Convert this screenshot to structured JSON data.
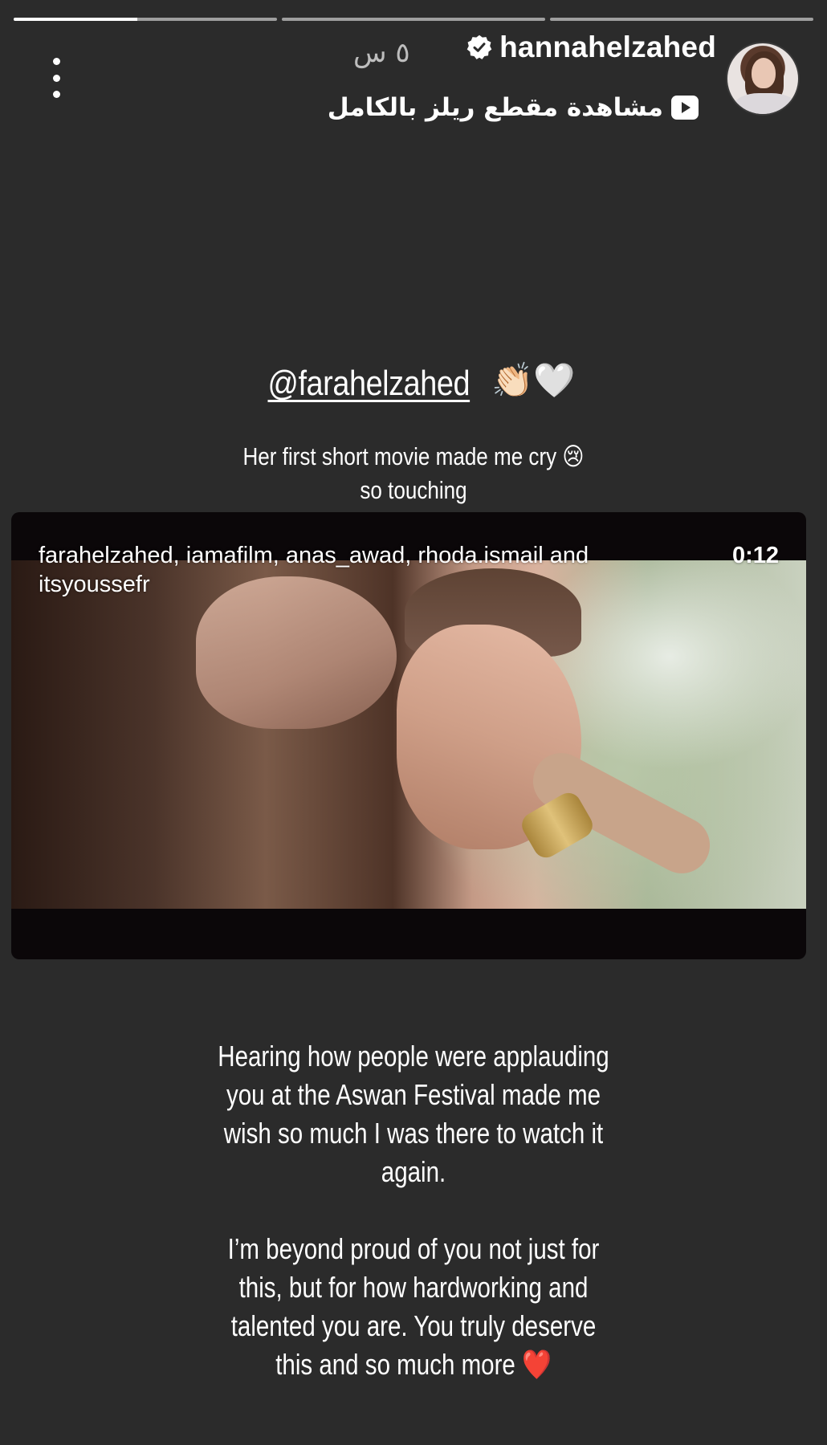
{
  "story": {
    "progress": [
      {
        "fill": 0.47
      },
      {
        "fill": 0
      },
      {
        "fill": 0
      }
    ]
  },
  "header": {
    "username": "hannahelzahed",
    "timestamp": "٥ س",
    "reels_link_label": "مشاهدة مقطع ريلز بالكامل",
    "icons": {
      "verified": "verified-badge-icon",
      "play": "play-icon",
      "more": "more-vertical-icon"
    }
  },
  "content": {
    "mention": "@farahelzahed",
    "mention_emoji": "👏🏻🤍",
    "caption_lines": [
      "Her first short movie made me cry 😢",
      "so touching"
    ],
    "reel": {
      "tags_line1": "farahelzahed, iamafilm, anas_awad, rhoda.ismail and",
      "tags_line2": "itsyoussefr",
      "duration": "0:12"
    },
    "body_lines_1": [
      "Hearing how people were applauding",
      "you at the Aswan Festival made me",
      "wish so much I was there to watch it",
      "again."
    ],
    "body_lines_2": [
      "I’m beyond proud of you not just for",
      "this, but for how hardworking and",
      "talented you are. You truly deserve",
      "this and so much more ❤️"
    ]
  },
  "colors": {
    "background": "#2b2b2b",
    "text": "#ffffff",
    "muted": "#bdbdbd"
  }
}
